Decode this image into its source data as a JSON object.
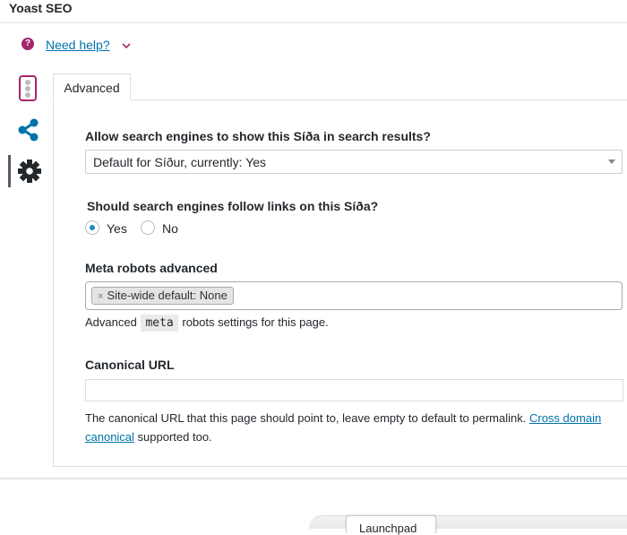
{
  "metabox": {
    "title": "Yoast SEO"
  },
  "help": {
    "icon": "question-icon",
    "icon_glyph": "?",
    "label": "Need help?"
  },
  "side_tabs": [
    {
      "name": "readability",
      "icon": "traffic-light-icon"
    },
    {
      "name": "social",
      "icon": "share-icon"
    },
    {
      "name": "advanced",
      "icon": "gear-icon"
    }
  ],
  "tab": {
    "label": "Advanced"
  },
  "fields": {
    "index": {
      "label": "Allow search engines to show this Síða in search results?",
      "selected": "Default for Síður, currently: Yes"
    },
    "follow": {
      "label": "Should search engines follow links on this Síða?",
      "options": [
        {
          "label": "Yes",
          "checked": true
        },
        {
          "label": "No",
          "checked": false
        }
      ]
    },
    "meta_robots": {
      "label": "Meta robots advanced",
      "tag_remove": "×",
      "tag": "Site-wide default: None",
      "desc_before": "Advanced ",
      "desc_code": "meta",
      "desc_after": " robots settings for this page."
    },
    "canonical": {
      "label": "Canonical URL",
      "value": "",
      "desc": "The canonical URL that this page should point to, leave empty to default to permalink. ",
      "link": "Cross domain canonical",
      "desc_after": " supported too."
    }
  },
  "launchpad": {
    "label": "Launchpad"
  },
  "colors": {
    "brand": "#a4286a",
    "link": "#0073aa",
    "radio": "#1e8cbe",
    "share": "#0073aa"
  }
}
